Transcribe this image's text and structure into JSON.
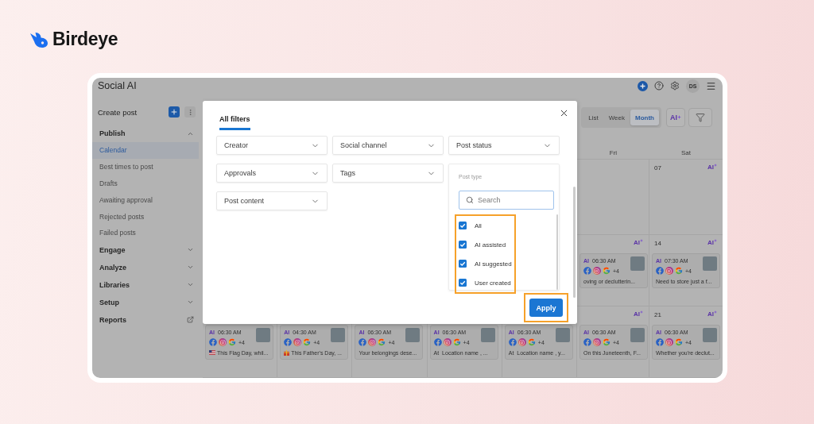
{
  "brand": {
    "name": "Birdeye"
  },
  "header": {
    "title": "Social AI",
    "avatar": "DS"
  },
  "sidebar": {
    "create_post": "Create post",
    "sections": [
      {
        "kind": "group",
        "label": "Publish",
        "expanded": true,
        "children": [
          {
            "label": "Calendar",
            "selected": true
          },
          {
            "label": "Best times to post",
            "selected": false
          },
          {
            "label": "Drafts",
            "selected": false
          },
          {
            "label": "Awaiting approval",
            "selected": false
          },
          {
            "label": "Rejected posts",
            "selected": false
          },
          {
            "label": "Failed posts",
            "selected": false
          }
        ]
      },
      {
        "kind": "group",
        "label": "Engage",
        "expanded": false
      },
      {
        "kind": "group",
        "label": "Analyze",
        "expanded": false
      },
      {
        "kind": "group",
        "label": "Libraries",
        "expanded": false
      },
      {
        "kind": "group",
        "label": "Setup",
        "expanded": false
      },
      {
        "kind": "link",
        "label": "Reports"
      }
    ]
  },
  "toolbar": {
    "views": [
      {
        "label": "List",
        "selected": false
      },
      {
        "label": "Week",
        "selected": false
      },
      {
        "label": "Month",
        "selected": true
      }
    ],
    "ai_button": "AI"
  },
  "calendar": {
    "columns": [
      {
        "cells": [
          {},
          {},
          {
            "posts": [
              {
                "kind": "flag",
                "badge": "AI",
                "time": "06:30 AM",
                "more": "+4",
                "text": "This Flag Day, whil..."
              }
            ]
          }
        ]
      },
      {
        "cells": [
          {},
          {},
          {
            "posts": [
              {
                "kind": "gift",
                "badge": "AI",
                "time": "04:30 AM",
                "more": "+4",
                "text": "This Father's Day, ..."
              }
            ]
          }
        ]
      },
      {
        "cells": [
          {},
          {},
          {
            "posts": [
              {
                "kind": "plain",
                "badge": "AI",
                "time": "06:30 AM",
                "more": "+4",
                "text": "Your belongings dese..."
              }
            ]
          }
        ]
      },
      {
        "cells": [
          {},
          {},
          {
            "posts": [
              {
                "kind": "plain",
                "badge": "AI",
                "time": "06:30 AM",
                "more": "+4",
                "text": "At  Location name , ..."
              }
            ]
          }
        ]
      },
      {
        "cells": [
          {},
          {},
          {
            "posts": [
              {
                "kind": "plain",
                "badge": "AI",
                "time": "06:30 AM",
                "more": "+4",
                "text": "At  Location name , y..."
              }
            ]
          }
        ]
      },
      {
        "header": "Fri",
        "cells": [
          {},
          {
            "ai_mark": "AI",
            "posts": [
              {
                "kind": "plain",
                "badge": "AI",
                "time": "06:30 AM",
                "more": "+4",
                "text": "oving or declutterin..."
              }
            ]
          },
          {
            "ai_mark": "AI",
            "posts": [
              {
                "kind": "plain",
                "badge": "AI",
                "time": "06:30 AM",
                "more": "+4",
                "text": "On this Juneteenth, F..."
              }
            ]
          }
        ]
      },
      {
        "header": "Sat",
        "cells": [
          {
            "date": "07",
            "ai_mark": "AI"
          },
          {
            "date": "14",
            "ai_mark": "AI",
            "posts": [
              {
                "kind": "plain",
                "badge": "AI",
                "time": "07:30 AM",
                "more": "+4",
                "text": "Need to store just a f..."
              }
            ]
          },
          {
            "date": "21",
            "ai_mark": "AI",
            "posts": [
              {
                "kind": "plain",
                "badge": "AI",
                "time": "06:30 AM",
                "more": "+4",
                "text": "Whether you're declut..."
              }
            ]
          }
        ]
      }
    ]
  },
  "filters_dialog": {
    "tabs": [
      {
        "label": "All filters",
        "selected": true
      }
    ],
    "dropdowns": [
      {
        "label": "Creator",
        "expanded": false
      },
      {
        "label": "Social channel",
        "expanded": false
      },
      {
        "label": "Post status",
        "expanded": false
      },
      {
        "label": "Approvals",
        "expanded": false
      },
      {
        "label": "Tags",
        "expanded": false
      },
      {
        "label": "Post type",
        "expanded": true,
        "search": {
          "placeholder": "Search"
        },
        "highlighted": true,
        "options": [
          {
            "label": "All",
            "checked": true
          },
          {
            "label": "AI assisted",
            "checked": true
          },
          {
            "label": "AI suggested",
            "checked": true
          },
          {
            "label": "User created",
            "checked": true
          }
        ]
      },
      {
        "label": "Post content",
        "expanded": false
      }
    ],
    "apply": {
      "label": "Apply",
      "highlighted": true
    }
  }
}
